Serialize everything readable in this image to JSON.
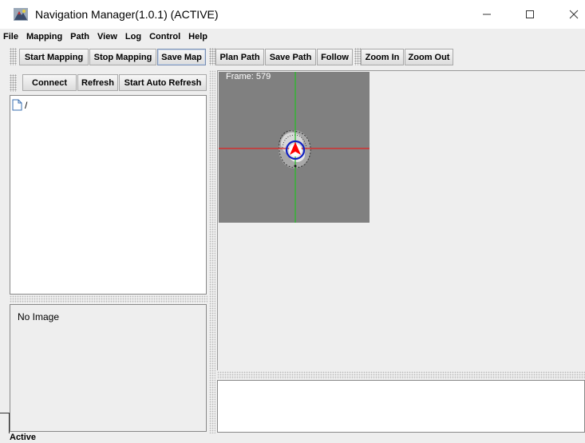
{
  "window": {
    "title": "Navigation Manager(1.0.1) (ACTIVE)",
    "controls": {
      "minimize": "—",
      "maximize": "☐",
      "close": "✕"
    }
  },
  "menubar": {
    "items": [
      "File",
      "Mapping",
      "Path",
      "View",
      "Log",
      "Control",
      "Help"
    ]
  },
  "toolbar": {
    "start_mapping": "Start Mapping",
    "stop_mapping": "Stop Mapping",
    "save_map": "Save Map",
    "plan_path": "Plan Path",
    "save_path": "Save Path",
    "follow": "Follow",
    "zoom_in": "Zoom In",
    "zoom_out": "Zoom Out"
  },
  "left_panel": {
    "connect": "Connect",
    "refresh": "Refresh",
    "start_auto_refresh": "Start Auto Refresh",
    "tree_root": "/",
    "image_placeholder": "No Image"
  },
  "map": {
    "frame_label": "Frame: 579",
    "x_axis_color": "#e02020",
    "y_axis_color": "#22c022",
    "robot_color": "#ff0000",
    "marker_color": "#1020c0"
  },
  "statusbar": {
    "status": "Active"
  }
}
